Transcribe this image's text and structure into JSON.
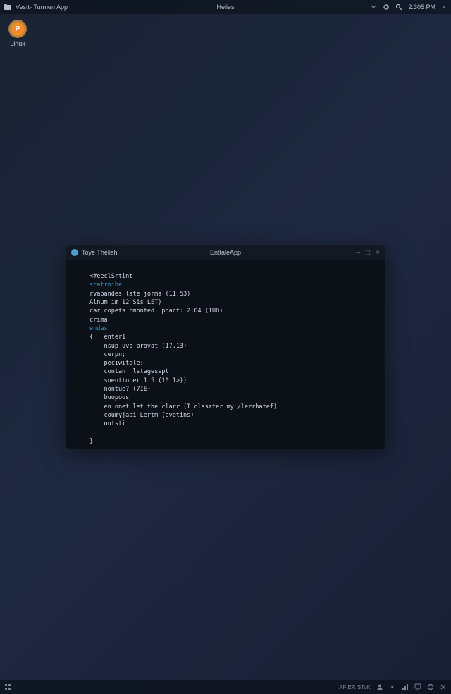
{
  "topbar": {
    "app_title": "Vestt- Turmen App",
    "center": "Helies",
    "time": "2:305 PM"
  },
  "desktop": {
    "icon_label": "Linux",
    "icon_badge": "P"
  },
  "terminal": {
    "title_left": "Toye Thelish",
    "title_center": "EnttaleApp",
    "minimize": "–",
    "maximize": "□",
    "close": "×",
    "code": {
      "l1": "<#eeclSrtint",
      "l2": "scatrnibe",
      "l3": "rvabandes late jorma (11.53)",
      "l4": "Alnum im 12 Sis LET)",
      "l5": "car copets cmonted, pnact: 2:04 (IUO)",
      "l6": "crima",
      "l7": "endas",
      "l8": "{   enter1",
      "l9": "    nsup uvo provat (17.13)",
      "l10": "    cerpn;",
      "l11": "    peciwitale;",
      "l12": "    contan  lstagesept",
      "l13": "    snenttoper 1:5 (10 1>))",
      "l14": "    nontue? (7IE)",
      "l15": "    buopoos",
      "l16": "    en onet let the clarr (I claszter my /lerrhatef)",
      "l17": "    coumyjasi Lertm (evetins)",
      "l18": "    outsti",
      "l19": "",
      "l20": "}"
    }
  },
  "taskbar": {
    "right_text": "AFtER SToK"
  }
}
